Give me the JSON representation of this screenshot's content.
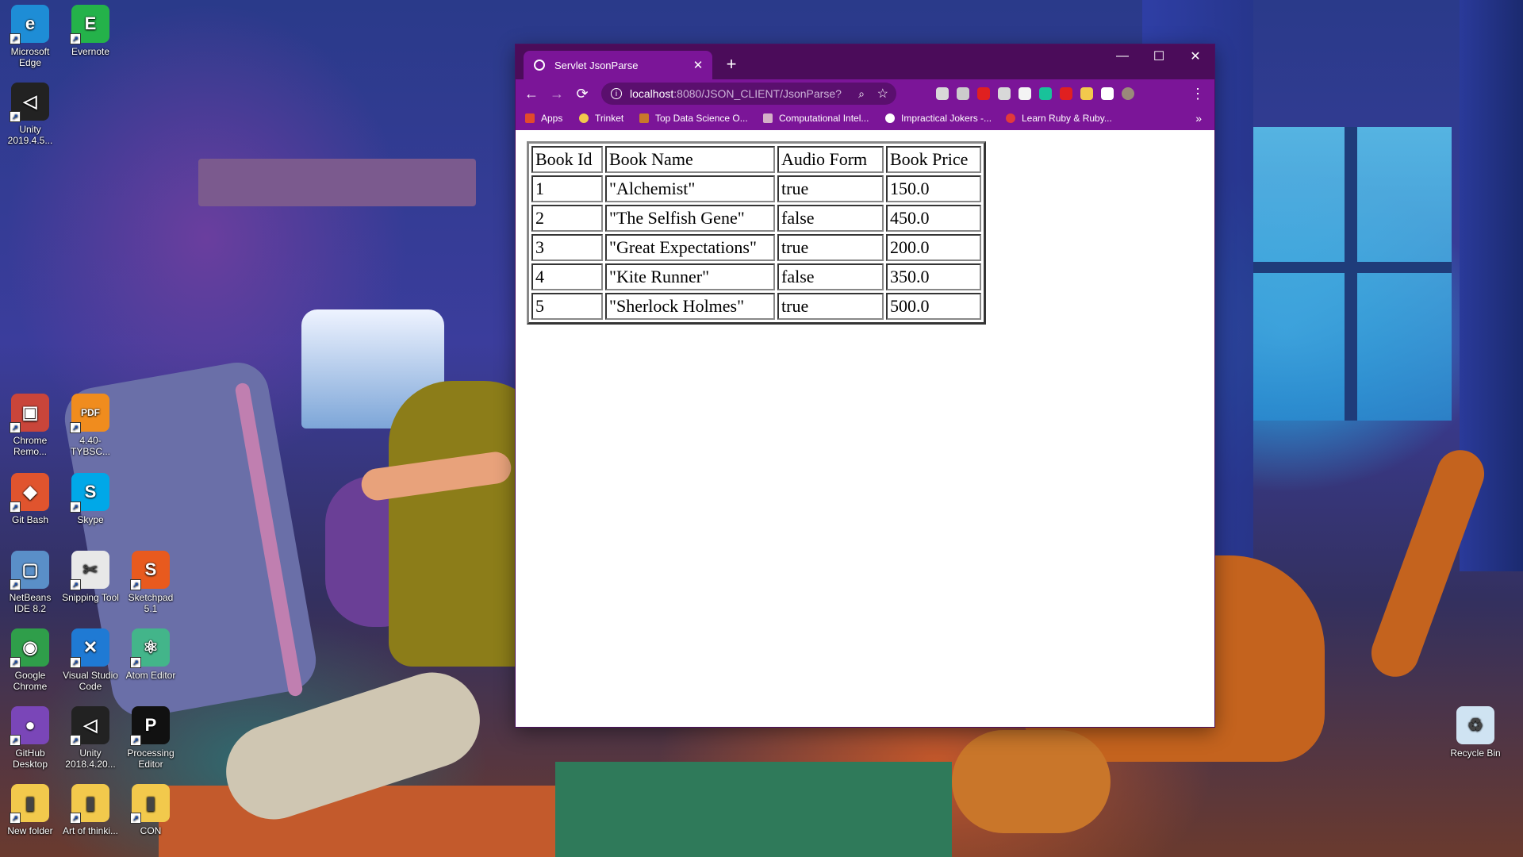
{
  "desktop": {
    "icons": [
      {
        "label": "Microsoft Edge",
        "color": "#1e8dd6",
        "glyph": "e"
      },
      {
        "label": "Evernote",
        "color": "#24b24a",
        "glyph": "E"
      },
      {
        "label": "Unity 2019.4.5...",
        "color": "#222222",
        "glyph": "◁"
      },
      {
        "label": "Chrome Remo...",
        "color": "#c9453a",
        "glyph": "▣"
      },
      {
        "label": "4.40-TYBSC...",
        "color": "#f08c1e",
        "glyph": "PDF"
      },
      {
        "label": "Git Bash",
        "color": "#e0542e",
        "glyph": "◆"
      },
      {
        "label": "Skype",
        "color": "#00a8e8",
        "glyph": "S"
      },
      {
        "label": "NetBeans IDE 8.2",
        "color": "#5a8fc8",
        "glyph": "▢"
      },
      {
        "label": "Snipping Tool",
        "color": "#e8e8e8",
        "glyph": "✂"
      },
      {
        "label": "Sketchpad 5.1",
        "color": "#e85a1e",
        "glyph": "S"
      },
      {
        "label": "Google Chrome",
        "color": "#2f9e4a",
        "glyph": "◉"
      },
      {
        "label": "Visual Studio Code",
        "color": "#1f7ad4",
        "glyph": "✕"
      },
      {
        "label": "Atom Editor",
        "color": "#43b58a",
        "glyph": "⚛"
      },
      {
        "label": "GitHub Desktop",
        "color": "#7a46b8",
        "glyph": "●"
      },
      {
        "label": "Unity 2018.4.20...",
        "color": "#222222",
        "glyph": "◁"
      },
      {
        "label": "Processing Editor",
        "color": "#111111",
        "glyph": "P"
      },
      {
        "label": "New folder",
        "color": "#f2c94c",
        "glyph": "▮"
      },
      {
        "label": "Art of thinki...",
        "color": "#f2c94c",
        "glyph": "▮"
      },
      {
        "label": "CON",
        "color": "#f2c94c",
        "glyph": "▮"
      },
      {
        "label": "Recycle Bin",
        "color": "#cfe3f2",
        "glyph": "♻"
      }
    ]
  },
  "browser": {
    "tab_title": "Servlet JsonParse",
    "new_tab": "+",
    "close_tab": "✕",
    "window_controls": {
      "minimize": "—",
      "maximize": "☐",
      "close": "✕"
    },
    "nav": {
      "back": "←",
      "forward": "→",
      "reload": "⟳",
      "menu": "⋮"
    },
    "url_host": "localhost",
    "url_path": ":8080/JSON_CLIENT/JsonParse?",
    "bookmarks": [
      {
        "label": "Apps",
        "color": "#e24a2c"
      },
      {
        "label": "Trinket",
        "color": "#f2c94c"
      },
      {
        "label": "Top Data Science O...",
        "color": "#c8782a"
      },
      {
        "label": "Computational Intel...",
        "color": "#d4b0c8"
      },
      {
        "label": "Impractical Jokers -...",
        "color": "#ffffff"
      },
      {
        "label": "Learn Ruby & Ruby...",
        "color": "#e23a3a"
      }
    ],
    "bookmarks_more": "»",
    "extension_colors": [
      "#d8d8d8",
      "#cccccc",
      "#e02020",
      "#d8d8d8",
      "#f4f4f4",
      "#18c29a",
      "#e02020",
      "#f2c94c",
      "#ffffff",
      "#9a8a7a"
    ]
  },
  "table": {
    "headers": [
      "Book Id",
      "Book Name",
      "Audio Form",
      "Book Price"
    ],
    "rows": [
      [
        "1",
        "\"Alchemist\"",
        "true",
        "150.0"
      ],
      [
        "2",
        "\"The Selfish Gene\"",
        "false",
        "450.0"
      ],
      [
        "3",
        "\"Great Expectations\"",
        "true",
        "200.0"
      ],
      [
        "4",
        "\"Kite Runner\"",
        "false",
        "350.0"
      ],
      [
        "5",
        "\"Sherlock Holmes\"",
        "true",
        "500.0"
      ]
    ]
  }
}
